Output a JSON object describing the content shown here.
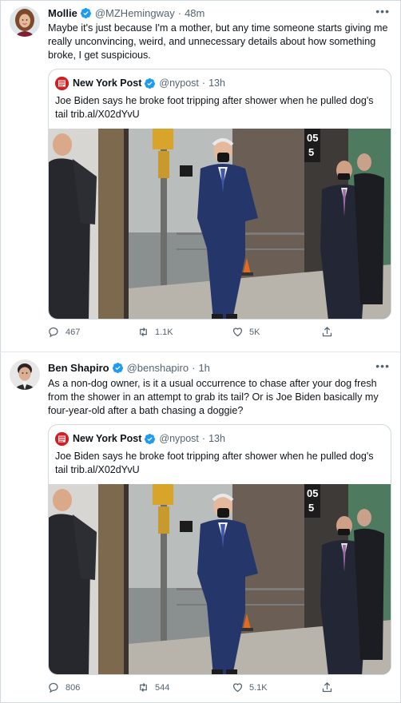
{
  "colors": {
    "verified": "#1d9bf0",
    "nypost_red": "#d21f26",
    "muted_text": "#536471",
    "border": "#cfd9de"
  },
  "tweets": [
    {
      "author": {
        "name": "Mollie",
        "handle": "@MZHemingway",
        "time": "48m",
        "verified": true
      },
      "text": "Maybe it's just because I'm a mother, but any time someone starts giving me really unconvincing, weird, and unnecessary details about how something broke, I get suspicious.",
      "quote": {
        "author": {
          "name": "New York Post",
          "handle": "@nypost",
          "time": "13h",
          "verified": true
        },
        "text": "Joe Biden says he broke foot tripping after shower when he pulled dog's tail trib.al/X02dYvU"
      },
      "stats": {
        "replies": "467",
        "retweets": "1.1K",
        "likes": "5K"
      }
    },
    {
      "author": {
        "name": "Ben Shapiro",
        "handle": "@benshapiro",
        "time": "1h",
        "verified": true
      },
      "text": "As a non-dog owner, is it a usual occurrence to chase after your dog fresh from the shower in an attempt to grab its tail? Or is Joe Biden basically my four-year-old after a bath chasing a doggie?",
      "quote": {
        "author": {
          "name": "New York Post",
          "handle": "@nypost",
          "time": "13h",
          "verified": true
        },
        "text": "Joe Biden says he broke foot tripping after shower when he pulled dog's tail trib.al/X02dYvU"
      },
      "stats": {
        "replies": "806",
        "retweets": "544",
        "likes": "5.1K"
      }
    }
  ],
  "ui": {
    "dot": "·",
    "more": "•••"
  },
  "photo": {
    "sign_digit_top": "05",
    "sign_digit_bottom": "5"
  }
}
